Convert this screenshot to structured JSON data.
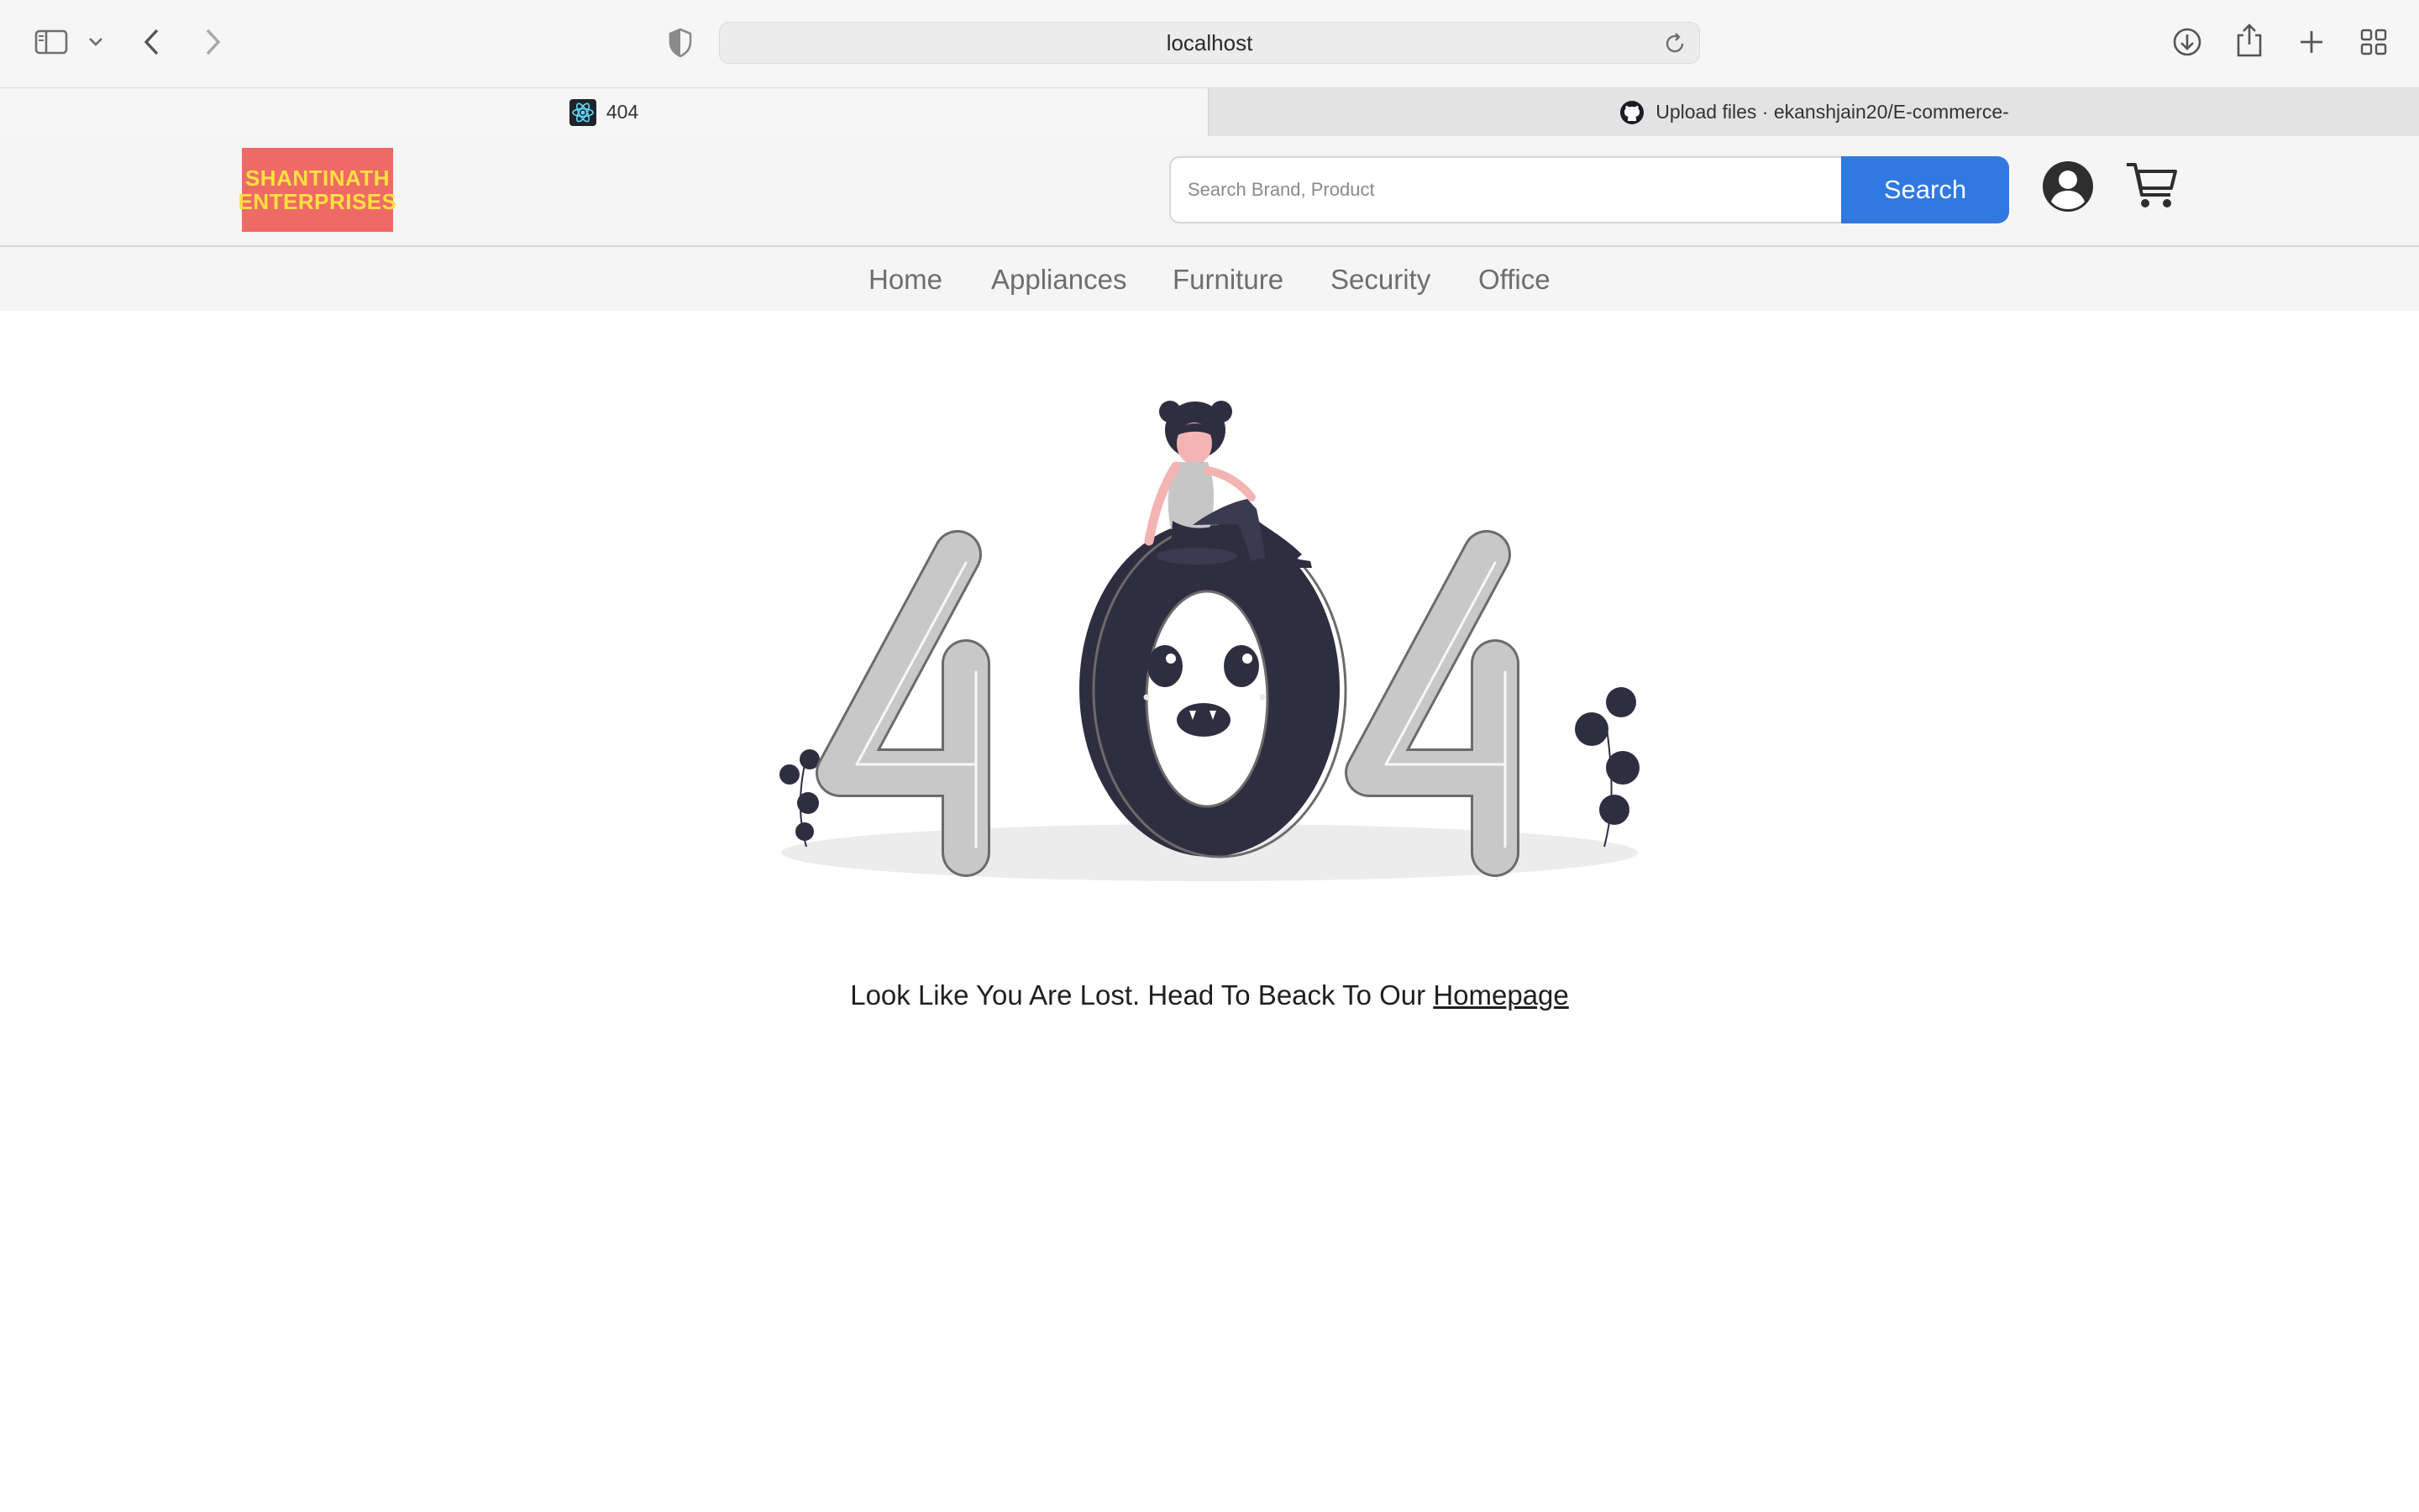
{
  "browser": {
    "url": "localhost",
    "icons": [
      "sidebar-icon",
      "chevron-down-icon",
      "back-icon",
      "forward-icon",
      "shield-icon",
      "reload-icon",
      "download-icon",
      "share-icon",
      "plus-icon",
      "grid-icon"
    ],
    "tabs": [
      {
        "title": "404",
        "favicon": "react-icon",
        "active": true
      },
      {
        "title": "Upload files · ekanshjain20/E-commerce-",
        "favicon": "github-icon",
        "active": false
      }
    ]
  },
  "site": {
    "logo_line1": "SHANTINATH",
    "logo_line2": "ENTERPRISES",
    "search_placeholder": "Search Brand, Product",
    "search_label": "Search",
    "nav": [
      "Home",
      "Appliances",
      "Furniture",
      "Security",
      "Office"
    ]
  },
  "error_page": {
    "code_illustration": "404",
    "message": "Look Like You Are Lost. Head To Beack To Our ",
    "link_text": "Homepage"
  },
  "colors": {
    "logo_bg": "#ef6a65",
    "logo_text": "#ffe040",
    "search_button": "#3178e0",
    "dark_figure": "#2f2e41"
  }
}
